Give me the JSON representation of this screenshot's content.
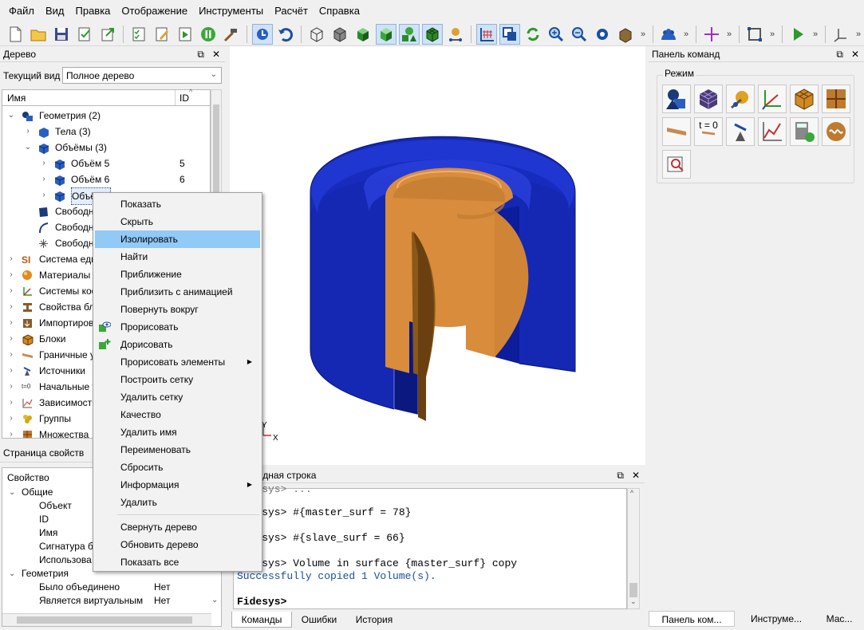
{
  "menu": [
    "Файл",
    "Вид",
    "Правка",
    "Отображение",
    "Инструменты",
    "Расчёт",
    "Справка"
  ],
  "tree": {
    "title": "Дерево",
    "view_label": "Текущий вид",
    "view_value": "Полное дерево",
    "col_name": "Имя",
    "col_id": "ID",
    "rows": [
      {
        "label": "Геометрия (2)",
        "id": ""
      },
      {
        "label": "Тела (3)",
        "id": ""
      },
      {
        "label": "Объёмы (3)",
        "id": ""
      },
      {
        "label": "Объём 5",
        "id": "5"
      },
      {
        "label": "Объём 6",
        "id": "6"
      },
      {
        "label": "Объём 7",
        "id": ""
      },
      {
        "label": "Свободные поверхности",
        "id": ""
      },
      {
        "label": "Свободные кривые",
        "id": ""
      },
      {
        "label": "Свободные вершины",
        "id": ""
      },
      {
        "label": "Система единиц",
        "id": ""
      },
      {
        "label": "Материалы",
        "id": ""
      },
      {
        "label": "Системы координат",
        "id": ""
      },
      {
        "label": "Свойства блоков",
        "id": ""
      },
      {
        "label": "Импортированные",
        "id": ""
      },
      {
        "label": "Блоки",
        "id": ""
      },
      {
        "label": "Граничные условия",
        "id": ""
      },
      {
        "label": "Источники",
        "id": ""
      },
      {
        "label": "Начальные условия",
        "id": ""
      },
      {
        "label": "Зависимости",
        "id": ""
      },
      {
        "label": "Группы",
        "id": ""
      },
      {
        "label": "Множества",
        "id": ""
      }
    ]
  },
  "context_menu": {
    "items": [
      "Показать",
      "Скрыть",
      "Изолировать",
      "Найти",
      "Приближение",
      "Приблизить с анимацией",
      "Повернуть вокруг",
      "Прорисовать",
      "Дорисовать",
      "Прорисовать элементы",
      "Построить сетку",
      "Удалить сетку",
      "Качество",
      "Удалить имя",
      "Переименовать",
      "Сбросить",
      "Информация",
      "Удалить",
      "Свернуть дерево",
      "Обновить дерево",
      "Показать все"
    ],
    "highlighted": "Изолировать",
    "submenu_arrow": "▶"
  },
  "props": {
    "title": "Страница свойств",
    "col_property": "Свойство",
    "group_general": "Общие",
    "object": "Объект",
    "id": "ID",
    "name": "Имя",
    "signature": "Сигнатура б",
    "used": "Использова",
    "group_geometry": "Геометрия",
    "merged_label": "Было объединено",
    "merged_value": "Нет",
    "virtual_label": "Является виртуальным",
    "virtual_value": "Нет"
  },
  "command_panel": {
    "title": "Панель команд",
    "mode_label": "Режим",
    "t0_label": "t = 0"
  },
  "cmdline": {
    "title": "Командная строка",
    "lines": [
      "Fidesys> #{master_surf = 78}",
      "Fidesys> #{slave_surf = 66}",
      "Fidesys> Volume in surface {master_surf} copy",
      "Successfully copied 1 Volume(s).",
      "Fidesys>"
    ],
    "tabs": [
      "Команды",
      "Ошибки",
      "История"
    ]
  },
  "bottom_tabs": [
    "Панель ком...",
    "Инструме...",
    "Мас..."
  ],
  "axes": {
    "x": "X",
    "y": "Y"
  },
  "colors": {
    "blue": "#1428b4",
    "orange": "#d88c3c",
    "highlight": "#91c9f7"
  }
}
